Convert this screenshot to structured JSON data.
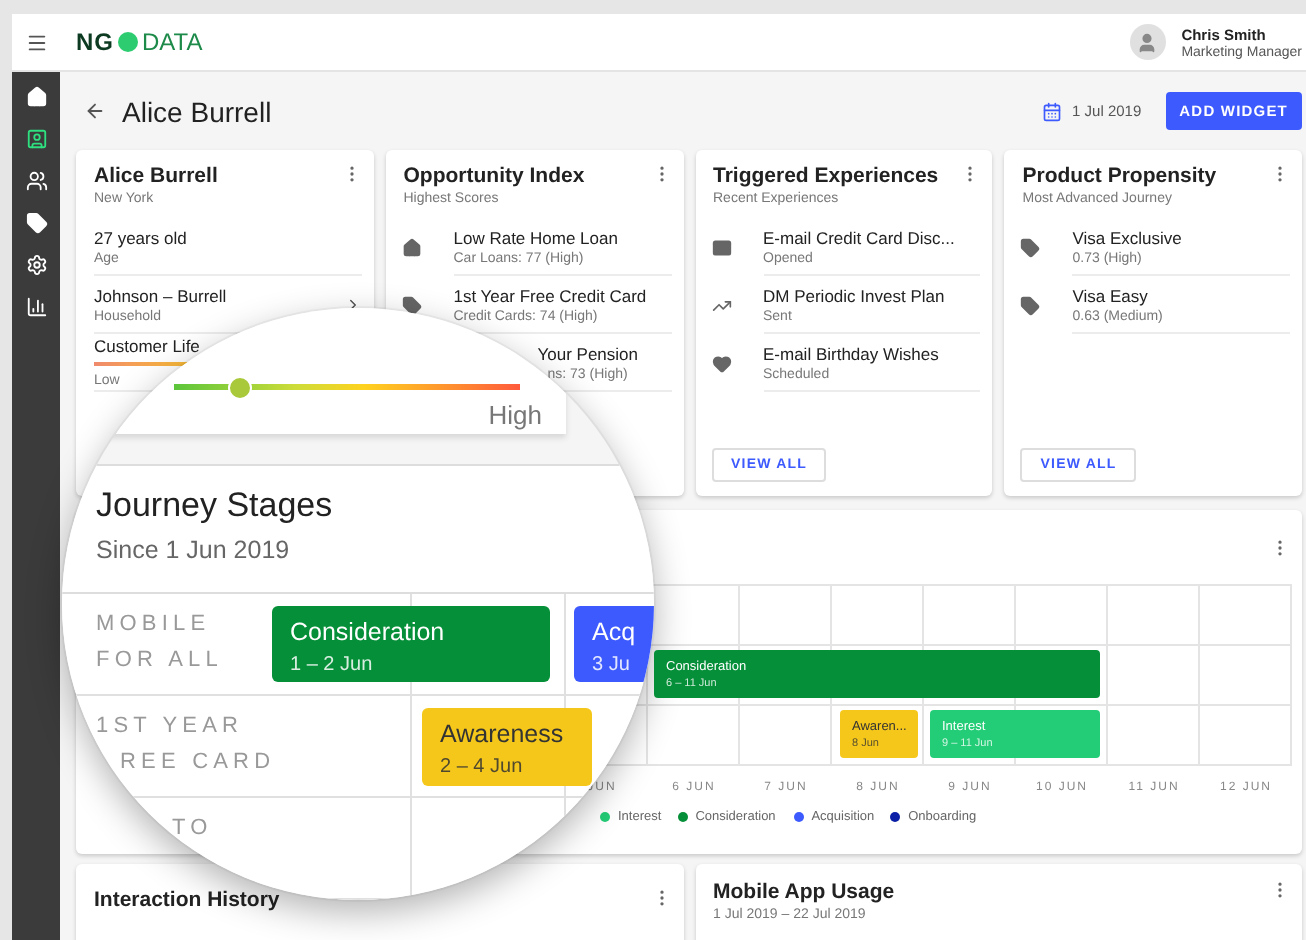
{
  "app_bar": {
    "logo": {
      "left": "NG",
      "right": "DATA"
    },
    "user": {
      "name": "Chris Smith",
      "role": "Marketing Manager"
    }
  },
  "sidebar": {
    "items": [
      {
        "kind": "home",
        "selected": false
      },
      {
        "kind": "contact",
        "selected": true
      },
      {
        "kind": "people",
        "selected": false
      },
      {
        "kind": "tag",
        "selected": false
      },
      {
        "kind": "settings",
        "selected": false
      },
      {
        "kind": "chart",
        "selected": false
      }
    ]
  },
  "header": {
    "title": "Alice Burrell",
    "date": "1 Jul 2019",
    "button": "ADD WIDGET"
  },
  "cards": [
    {
      "kind": "profile",
      "title": "Alice Burrell",
      "subtitle": "New York",
      "items": [
        {
          "kind": "plain",
          "value": "27 years old",
          "label": "Age"
        },
        {
          "kind": "link",
          "value": "Johnson – Burrell",
          "label": "Household"
        },
        {
          "kind": "gauge",
          "value": "Customer Life",
          "label": "Low"
        }
      ]
    },
    {
      "kind": "list",
      "title": "Opportunity Index",
      "subtitle": "Highest Scores",
      "items": [
        {
          "kind": "home",
          "value": "Low Rate Home Loan",
          "label": "Car Loans: 77 (High)"
        },
        {
          "kind": "tag",
          "value": "1st Year Free Credit Card",
          "label": "Credit Cards: 74 (High)"
        },
        {
          "kind": "covered",
          "value": "Your Pension",
          "label": "ns: 73 (High)"
        }
      ]
    },
    {
      "kind": "list",
      "title": "Triggered Experiences",
      "subtitle": "Recent Experiences",
      "button": "VIEW ALL",
      "items": [
        {
          "kind": "mail",
          "value": "E-mail Credit Card Disc...",
          "label": "Opened"
        },
        {
          "kind": "trend",
          "value": "DM Periodic Invest Plan",
          "label": "Sent"
        },
        {
          "kind": "heart",
          "value": "E-mail Birthday Wishes",
          "label": "Scheduled"
        }
      ]
    },
    {
      "kind": "list",
      "title": "Product Propensity",
      "subtitle": "Most Advanced Journey",
      "button": "VIEW ALL",
      "items": [
        {
          "kind": "tag",
          "value": "Visa Exclusive",
          "label": "0.73 (High)"
        },
        {
          "kind": "tag",
          "value": "Visa Easy",
          "label": "0.63 (Medium)"
        }
      ]
    }
  ],
  "journey_chart": {
    "axis": [
      "JUN",
      "6 JUN",
      "7 JUN",
      "8 JUN",
      "9 JUN",
      "10 JUN",
      "11 JUN",
      "12 JUN"
    ],
    "bars": [
      {
        "label": "Consideration",
        "dates": "6 – 11 Jun",
        "color": "#058f38"
      },
      {
        "label": "Awaren...",
        "dates": "8 Jun",
        "color": "#f5c71a"
      },
      {
        "label": "Interest",
        "dates": "9 – 11 Jun",
        "color": "#23cc76"
      }
    ],
    "legend": [
      {
        "label": "Interest",
        "color": "#23cc76"
      },
      {
        "label": "Consideration",
        "color": "#058f38"
      },
      {
        "label": "Acquisition",
        "color": "#3d5afe"
      },
      {
        "label": "Onboarding",
        "color": "#0b1fa6"
      }
    ]
  },
  "magnifier": {
    "slider": {
      "level": 0.185,
      "label": "High"
    },
    "title": "Journey Stages",
    "subtitle": "Since 1 Jun 2019",
    "lanes": [
      {
        "lines": [
          "MOBILE",
          "FOR ALL"
        ]
      },
      {
        "lines": [
          "1ST YEAR",
          "REE CARD"
        ]
      },
      {
        "lines": [
          "TO"
        ]
      }
    ],
    "bars": [
      {
        "label": "Consideration",
        "dates": "1 – 2 Jun",
        "color": "#058f38"
      },
      {
        "label": "Acq",
        "dates": "3 Ju",
        "color": "#3d5afe"
      },
      {
        "label": "Awareness",
        "dates": "2 – 4 Jun",
        "color": "#f5c71a"
      }
    ]
  },
  "bottom_cards": [
    {
      "title": "Interaction History"
    },
    {
      "title": "Mobile App Usage",
      "subtitle": "1 Jul 2019 – 22 Jul 2019"
    }
  ]
}
